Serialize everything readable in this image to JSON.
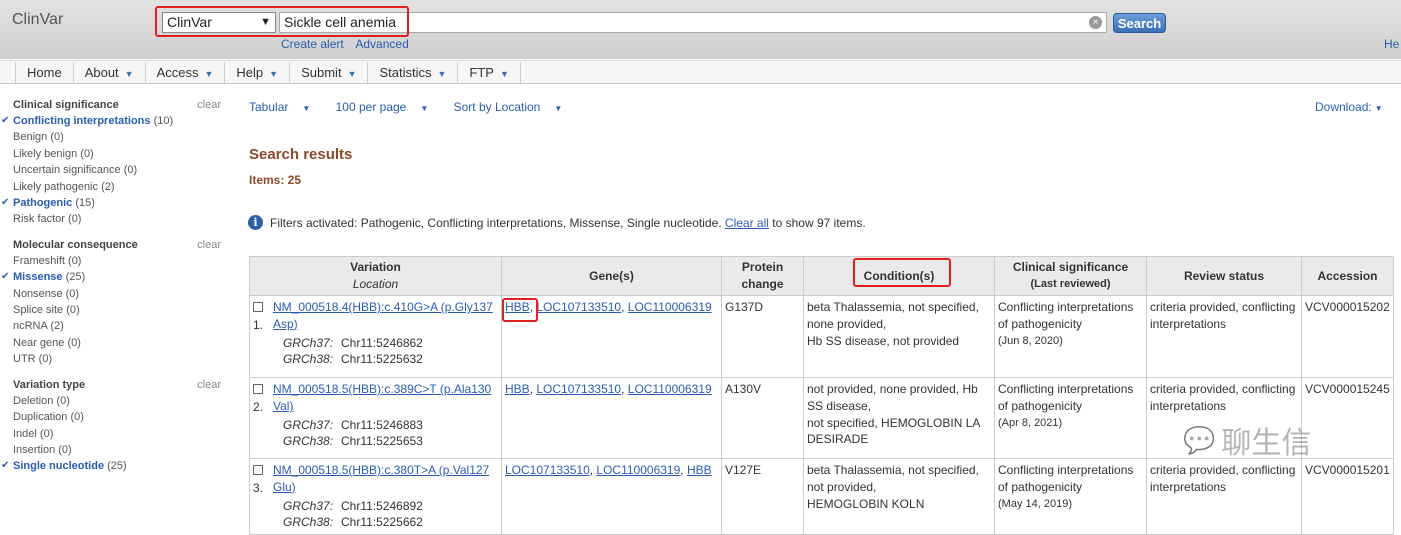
{
  "header": {
    "logo": "ClinVar",
    "db_select": "ClinVar",
    "search_value": "Sickle cell anemia",
    "clear_symbol": "×",
    "search_label": "Search",
    "links": [
      "Create alert",
      "Advanced"
    ],
    "help": "He"
  },
  "nav": [
    {
      "label": "Home",
      "menu": false
    },
    {
      "label": "About",
      "menu": true
    },
    {
      "label": "Access",
      "menu": true
    },
    {
      "label": "Help",
      "menu": true
    },
    {
      "label": "Submit",
      "menu": true
    },
    {
      "label": "Statistics",
      "menu": true
    },
    {
      "label": "FTP",
      "menu": true
    }
  ],
  "filters": [
    {
      "title": "Clinical significance",
      "clear": "clear",
      "items": [
        {
          "label": "Conflicting interpretations",
          "count": "(10)",
          "selected": true
        },
        {
          "label": "Benign",
          "count": "(0)",
          "selected": false
        },
        {
          "label": "Likely benign",
          "count": "(0)",
          "selected": false
        },
        {
          "label": "Uncertain significance",
          "count": "(0)",
          "selected": false
        },
        {
          "label": "Likely pathogenic",
          "count": "(2)",
          "selected": false
        },
        {
          "label": "Pathogenic",
          "count": "(15)",
          "selected": true
        },
        {
          "label": "Risk factor",
          "count": "(0)",
          "selected": false
        }
      ]
    },
    {
      "title": "Molecular consequence",
      "clear": "clear",
      "items": [
        {
          "label": "Frameshift",
          "count": "(0)",
          "selected": false
        },
        {
          "label": "Missense",
          "count": "(25)",
          "selected": true
        },
        {
          "label": "Nonsense",
          "count": "(0)",
          "selected": false
        },
        {
          "label": "Splice site",
          "count": "(0)",
          "selected": false
        },
        {
          "label": "ncRNA",
          "count": "(2)",
          "selected": false
        },
        {
          "label": "Near gene",
          "count": "(0)",
          "selected": false
        },
        {
          "label": "UTR",
          "count": "(0)",
          "selected": false
        }
      ]
    },
    {
      "title": "Variation type",
      "clear": "clear",
      "items": [
        {
          "label": "Deletion",
          "count": "(0)",
          "selected": false
        },
        {
          "label": "Duplication",
          "count": "(0)",
          "selected": false
        },
        {
          "label": "Indel",
          "count": "(0)",
          "selected": false
        },
        {
          "label": "Insertion",
          "count": "(0)",
          "selected": false
        },
        {
          "label": "Single nucleotide",
          "count": "(25)",
          "selected": true
        }
      ]
    }
  ],
  "controls": {
    "format": "Tabular",
    "per_page": "100 per page",
    "sort": "Sort by Location",
    "download": "Download:"
  },
  "results": {
    "title": "Search results",
    "items": "Items: 25",
    "filter_notice": {
      "info_icon": "i",
      "prefix": "Filters activated: Pathogenic, Conflicting interpretations, Missense, Single nucleotide.",
      "link": "Clear all",
      "suffix": "to show 97 items."
    }
  },
  "table": {
    "headers": {
      "variation": "Variation",
      "location": "Location",
      "genes": "Gene(s)",
      "protein_change": "Protein change",
      "conditions": "Condition(s)",
      "clinical_significance": "Clinical significance",
      "last_reviewed": "(Last reviewed)",
      "review_status": "Review status",
      "accession": "Accession"
    },
    "rows": [
      {
        "num": "1.",
        "variation": "NM_000518.4(HBB):c.410G>A (p.Gly137Asp)",
        "grch37_label": "GRCh37:",
        "grch37": "Chr11:5246862",
        "grch38_label": "GRCh38:",
        "grch38": "Chr11:5225632",
        "genes": [
          "HBB",
          "LOC107133510",
          "LOC110006319"
        ],
        "protein": "G137D",
        "conditions": [
          "beta Thalassemia, not specified,",
          "none provided,",
          "Hb SS disease, not provided"
        ],
        "significance": "Conflicting interpretations of pathogenicity",
        "date": "(Jun 8, 2020)",
        "review": "criteria provided, conflicting interpretations",
        "accession": "VCV000015202"
      },
      {
        "num": "2.",
        "variation": "NM_000518.5(HBB):c.389C>T (p.Ala130Val)",
        "grch37_label": "GRCh37:",
        "grch37": "Chr11:5246883",
        "grch38_label": "GRCh38:",
        "grch38": "Chr11:5225653",
        "genes": [
          "HBB",
          "LOC107133510",
          "LOC110006319"
        ],
        "protein": "A130V",
        "conditions": [
          "not provided, none provided, Hb SS disease,",
          "not specified, HEMOGLOBIN LA DESIRADE"
        ],
        "significance": "Conflicting interpretations of pathogenicity",
        "date": "(Apr 8, 2021)",
        "review": "criteria provided, conflicting interpretations",
        "accession": "VCV000015245"
      },
      {
        "num": "3.",
        "variation": "NM_000518.5(HBB):c.380T>A (p.Val127Glu)",
        "grch37_label": "GRCh37:",
        "grch37": "Chr11:5246892",
        "grch38_label": "GRCh38:",
        "grch38": "Chr11:5225662",
        "genes": [
          "LOC107133510",
          "LOC110006319",
          "HBB"
        ],
        "protein": "V127E",
        "conditions": [
          "beta Thalassemia, not specified,",
          "not provided,",
          "HEMOGLOBIN KOLN"
        ],
        "significance": "Conflicting interpretations of pathogenicity",
        "date": "(May 14, 2019)",
        "review": "criteria provided, conflicting interpretations",
        "accession": "VCV000015201"
      }
    ]
  },
  "watermark": {
    "icon": "wechat-icon",
    "text": "聊生信"
  }
}
